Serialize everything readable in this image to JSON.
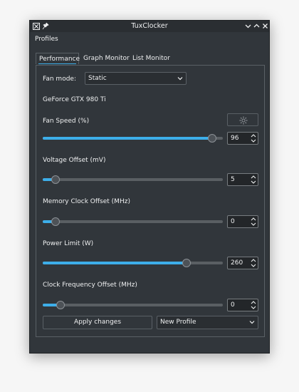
{
  "window": {
    "title": "TuxClocker"
  },
  "menu": {
    "profiles_label": "Profiles"
  },
  "tabs": [
    {
      "label": "Performance",
      "active": true
    },
    {
      "label": "Graph Monitor",
      "active": false
    },
    {
      "label": "List Monitor",
      "active": false
    }
  ],
  "fan_mode": {
    "label": "Fan mode:",
    "value": "Static"
  },
  "gpu_name": "GeForce GTX 980 Ti",
  "controls": [
    {
      "label": "Fan Speed (%)",
      "value": "96",
      "fraction": 0.94
    },
    {
      "label": "Voltage Offset (mV)",
      "value": "5",
      "fraction": 0.07
    },
    {
      "label": "Memory Clock Offset (MHz)",
      "value": "0",
      "fraction": 0.07
    },
    {
      "label": "Power Limit (W)",
      "value": "260",
      "fraction": 0.8
    },
    {
      "label": "Clock Frequency Offset (MHz)",
      "value": "0",
      "fraction": 0.1
    }
  ],
  "buttons": {
    "apply": "Apply changes"
  },
  "profile_select": {
    "value": "New Profile"
  },
  "colors": {
    "accent": "#3daee9",
    "window_bg": "#31363b"
  },
  "icons": {
    "fan_settings": "gear-icon",
    "app": "app-icon",
    "pin": "pin-icon"
  }
}
